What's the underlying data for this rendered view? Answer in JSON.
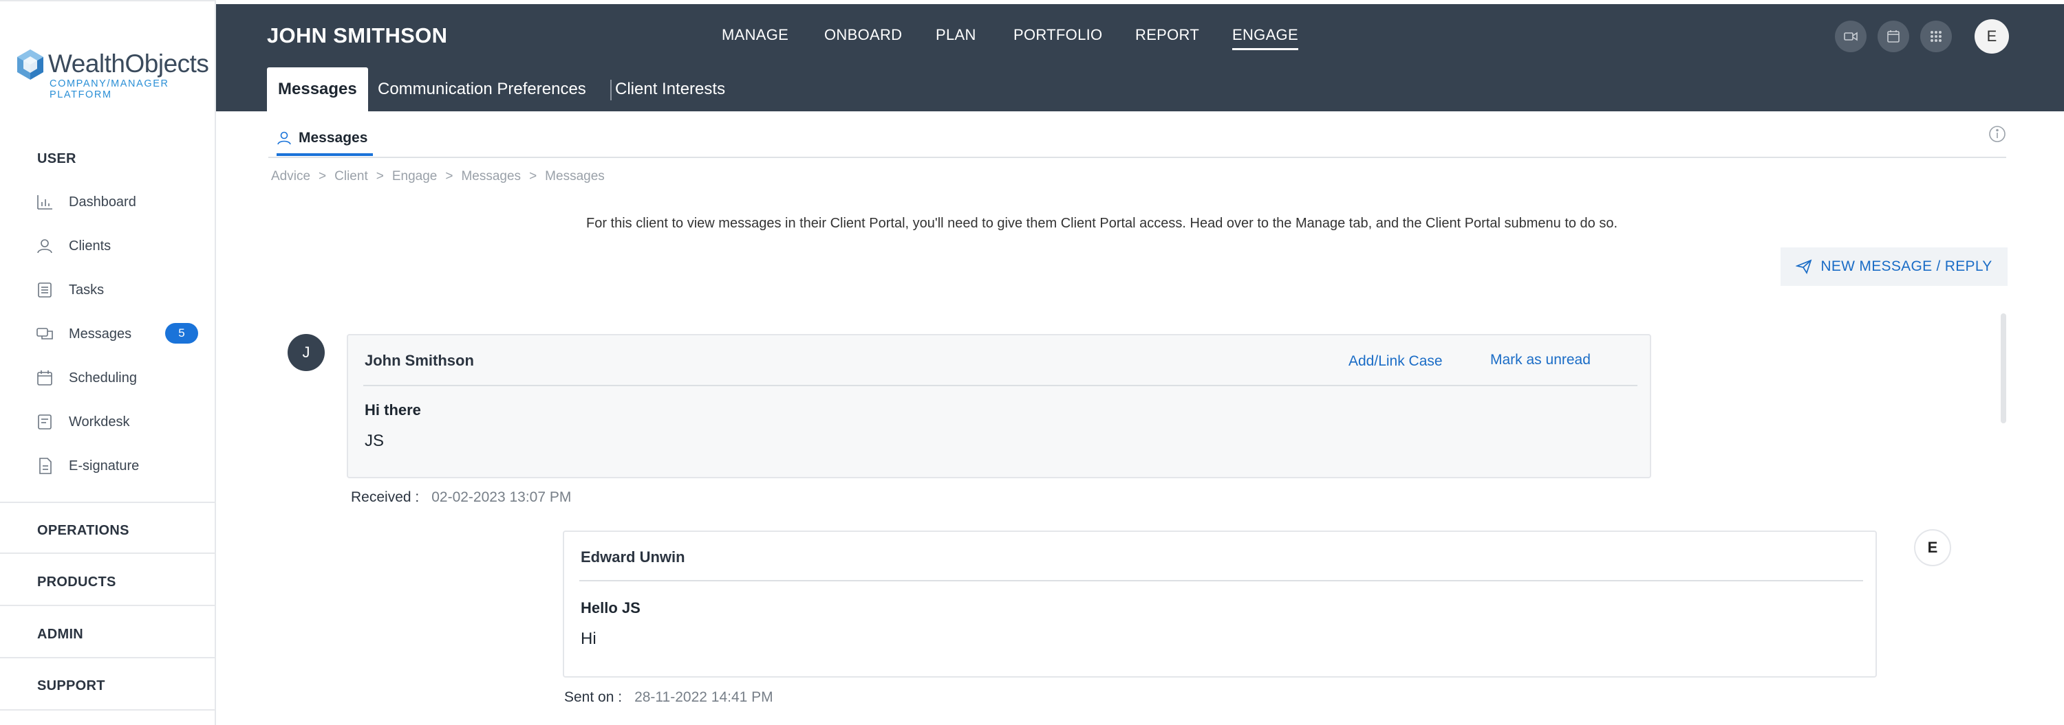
{
  "sidebar": {
    "logo_name": "WealthObjects",
    "logo_tagline": "COMPANY/MANAGER PLATFORM",
    "section_user": "USER",
    "items": [
      {
        "label": "Dashboard",
        "icon": "chart-icon"
      },
      {
        "label": "Clients",
        "icon": "user-icon"
      },
      {
        "label": "Tasks",
        "icon": "tasks-icon"
      },
      {
        "label": "Messages",
        "icon": "messages-icon",
        "badge": "5"
      },
      {
        "label": "Scheduling",
        "icon": "calendar-icon"
      },
      {
        "label": "Workdesk",
        "icon": "workdesk-icon"
      },
      {
        "label": "E-signature",
        "icon": "document-icon"
      }
    ],
    "sections": [
      "OPERATIONS",
      "PRODUCTS",
      "ADMIN",
      "SUPPORT"
    ]
  },
  "header": {
    "client_name": "JOHN SMITHSON",
    "nav": [
      "MANAGE",
      "ONBOARD",
      "PLAN",
      "PORTFOLIO",
      "REPORT",
      "ENGAGE"
    ],
    "active_nav": "ENGAGE",
    "avatar_initial": "E",
    "icons": [
      "video-icon",
      "calendar-icon",
      "apps-grid-icon"
    ],
    "subtabs": [
      "Messages",
      "Communication Preferences",
      "Client Interests"
    ],
    "active_subtab": "Messages"
  },
  "content": {
    "tab_label": "Messages",
    "breadcrumb": [
      "Advice",
      ">",
      "Client",
      ">",
      "Engage",
      ">",
      "Messages",
      ">",
      "Messages"
    ],
    "notice": "For this client to view messages in their Client Portal, you'll need to give them Client Portal access. Head over to the Manage tab, and the Client Portal submenu to do so.",
    "new_message_label": "NEW MESSAGE / REPLY"
  },
  "messages": [
    {
      "avatar": "J",
      "sender": "John Smithson",
      "subject": "Hi there",
      "body": "JS",
      "link_case": "Add/Link Case",
      "link_unread": "Mark as unread",
      "meta_label": "Received :",
      "meta_value": "02-02-2023 13:07 PM"
    },
    {
      "avatar": "E",
      "sender": "Edward Unwin",
      "subject": "Hello JS",
      "body": "Hi",
      "meta_label": "Sent on :",
      "meta_value": "28-11-2022 14:41 PM"
    }
  ],
  "colors": {
    "header_bg": "#364250",
    "accent": "#1a73d9",
    "link": "#1a6cc6"
  }
}
